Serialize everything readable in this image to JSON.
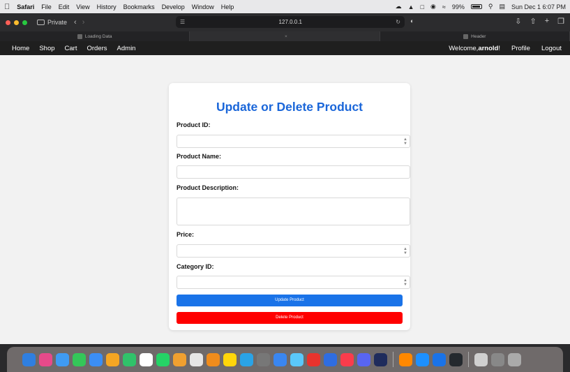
{
  "menubar": {
    "app": "Safari",
    "items": [
      "File",
      "Edit",
      "View",
      "History",
      "Bookmarks",
      "Develop",
      "Window",
      "Help"
    ],
    "battery": "99%",
    "clock": "Sun Dec 1  6:07 PM"
  },
  "toolbar": {
    "private_label": "Private",
    "url": "127.0.0.1"
  },
  "tabs": [
    {
      "label": "Loading Data",
      "active": false
    },
    {
      "label": "",
      "active": true
    },
    {
      "label": "Header",
      "active": false
    }
  ],
  "sitenav": {
    "left": [
      "Home",
      "Shop",
      "Cart",
      "Orders",
      "Admin"
    ],
    "welcome_prefix": "Welcome,",
    "username": "arnold",
    "welcome_suffix": "!",
    "profile": "Profile",
    "logout": "Logout"
  },
  "form": {
    "title": "Update or Delete Product",
    "product_id_label": "Product ID:",
    "product_name_label": "Product Name:",
    "description_label": "Product Description:",
    "price_label": "Price:",
    "category_label": "Category ID:",
    "update_button": "Update Product",
    "delete_button": "Delete Product"
  },
  "dock": {
    "colors": [
      "#2f7fe0",
      "#e64a8a",
      "#3f9bf2",
      "#34c759",
      "#3b8ef5",
      "#f5a623",
      "#30c26a",
      "#ffffff",
      "#25d366",
      "#f0a030",
      "#e6e6e6",
      "#f08c1c",
      "#ffd60a",
      "#2aa3e6",
      "#777777",
      "#3a86f0",
      "#5ac8fa",
      "#e8332d",
      "#2f6de0",
      "#fa3c4c",
      "#5865f2",
      "#1f2c5c",
      "#ff8800",
      "#1d90ff",
      "#1a73e8",
      "#24292e",
      "#d0d0d0",
      "#888888",
      "#aaaaaa"
    ]
  },
  "colors": {
    "accent": "#1a66d9",
    "update_button": "#1a73e8",
    "delete_button": "#ff0000",
    "navbar": "#1f1f1f"
  }
}
